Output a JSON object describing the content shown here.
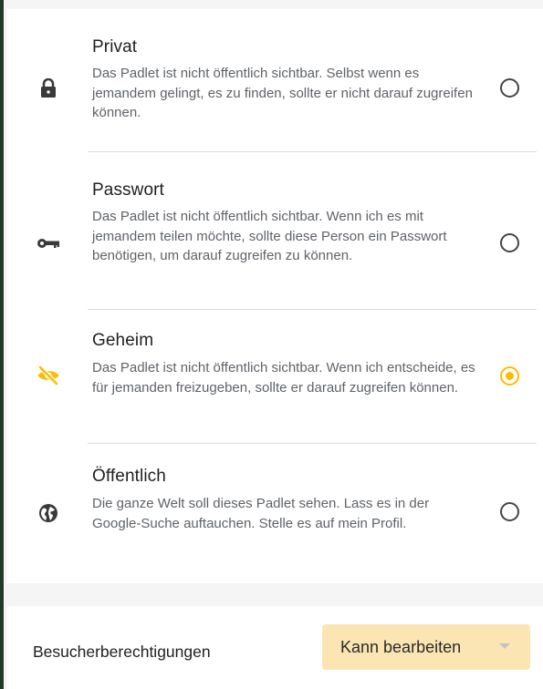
{
  "options": [
    {
      "id": "privat",
      "title": "Privat",
      "description": "Das Padlet ist nicht öffentlich sichtbar. Selbst wenn es jemandem gelingt, es zu finden, sollte er nicht darauf zugreifen können.",
      "icon": "lock-icon",
      "selected": false
    },
    {
      "id": "passwort",
      "title": "Passwort",
      "description": "Das Padlet ist nicht öffentlich sichtbar. Wenn ich es mit jemandem teilen möchte, sollte diese Person ein Passwort benötigen, um darauf zugreifen zu können.",
      "icon": "key-icon",
      "selected": false
    },
    {
      "id": "geheim",
      "title": "Geheim",
      "description": "Das Padlet ist nicht öffentlich sichtbar. Wenn ich entscheide, es für jemanden freizugeben, sollte er darauf zugreifen können.",
      "icon": "eye-off-icon",
      "selected": true
    },
    {
      "id": "oeffentlich",
      "title": "Öffentlich",
      "description": "Die ganze Welt soll dieses Padlet sehen. Lass es in der Google-Suche auftauchen. Stelle es auf mein Profil.",
      "icon": "globe-icon",
      "selected": false
    }
  ],
  "visitor_permissions": {
    "label": "Besucherberechtigungen",
    "value": "Kann bearbeiten"
  },
  "colors": {
    "accent": "#fbbd00",
    "select_bg": "#fbe6b3",
    "left_border": "#1f3a2b"
  }
}
